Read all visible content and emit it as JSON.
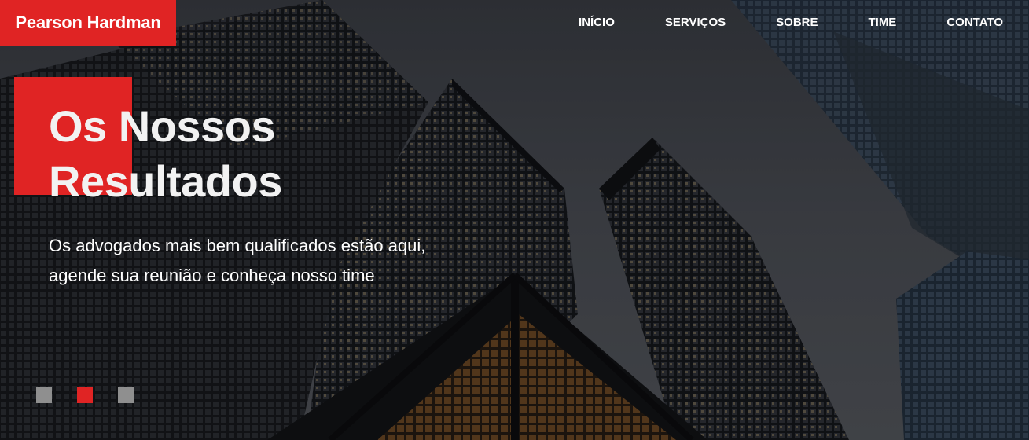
{
  "brand": {
    "name": "Pearson Hardman",
    "accent_color": "#e02424"
  },
  "nav": {
    "items": [
      {
        "label": "INÍCIO"
      },
      {
        "label": "SERVIÇOS"
      },
      {
        "label": "SOBRE"
      },
      {
        "label": "TIME"
      },
      {
        "label": "CONTATO"
      }
    ]
  },
  "hero": {
    "title_line1": "Os Nossos",
    "title_line2": "Resultados",
    "subtitle_line1": "Os advogados mais bem qualificados estão aqui,",
    "subtitle_line2": "agende sua reunião e conheça nosso time",
    "background_image": "city-skyscrapers-photo"
  },
  "carousel": {
    "slide_count": 3,
    "active_index": 1,
    "active_color": "#e02424",
    "inactive_color": "#8f8f8f"
  }
}
